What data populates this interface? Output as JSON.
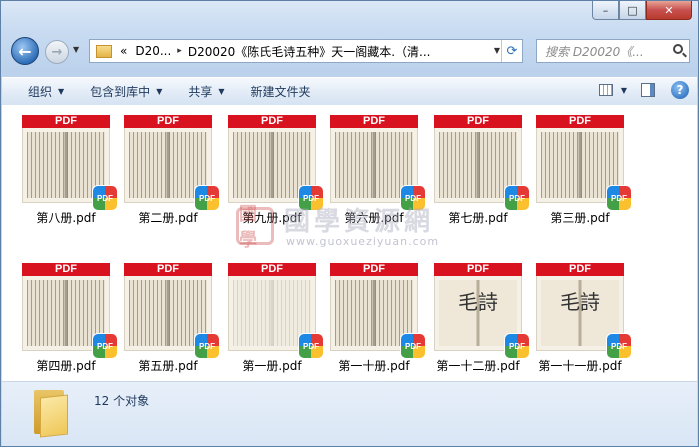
{
  "window": {
    "caption": {
      "minimize": "–",
      "maximize": "□",
      "close": "✕"
    }
  },
  "nav": {
    "back_glyph": "←",
    "forward_glyph": "→",
    "dropdown_glyph": "▼",
    "address": {
      "prefix": "«",
      "parent": "D20...",
      "separator": "▸",
      "current": "D20020《陈氏毛诗五种》天一阁藏本.（清...",
      "dropdown_glyph": "▼"
    },
    "refresh_glyph": "⟳",
    "search_placeholder": "搜索 D20020《..."
  },
  "toolbar": {
    "items": [
      {
        "label": "组织",
        "has_menu": true
      },
      {
        "label": "包含到库中",
        "has_menu": true
      },
      {
        "label": "共享",
        "has_menu": true
      },
      {
        "label": "新建文件夹",
        "has_menu": false
      }
    ],
    "menu_arrow": "▼",
    "help_glyph": "?"
  },
  "files": [
    {
      "name": "第八册.pdf",
      "band": "PDF",
      "badge": "PDF",
      "style": "scan"
    },
    {
      "name": "第二册.pdf",
      "band": "PDF",
      "badge": "PDF",
      "style": "scan"
    },
    {
      "name": "第九册.pdf",
      "band": "PDF",
      "badge": "PDF",
      "style": "scan"
    },
    {
      "name": "第六册.pdf",
      "band": "PDF",
      "badge": "PDF",
      "style": "scan"
    },
    {
      "name": "第七册.pdf",
      "band": "PDF",
      "badge": "PDF",
      "style": "scan"
    },
    {
      "name": "第三册.pdf",
      "band": "PDF",
      "badge": "PDF",
      "style": "scan"
    },
    {
      "name": "第四册.pdf",
      "band": "PDF",
      "badge": "PDF",
      "style": "scan"
    },
    {
      "name": "第五册.pdf",
      "band": "PDF",
      "badge": "PDF",
      "style": "scan"
    },
    {
      "name": "第一册.pdf",
      "band": "PDF",
      "badge": "PDF",
      "style": "light"
    },
    {
      "name": "第一十册.pdf",
      "band": "PDF",
      "badge": "PDF",
      "style": "scan"
    },
    {
      "name": "第一十二册.pdf",
      "band": "PDF",
      "badge": "PDF",
      "style": "big",
      "glyphs": "毛詩"
    },
    {
      "name": "第一十一册.pdf",
      "band": "PDF",
      "badge": "PDF",
      "style": "big",
      "glyphs": "毛詩"
    }
  ],
  "watermark": {
    "seal": "國學",
    "title": "國學資源網",
    "url": "www.guoxueziyuan.com"
  },
  "status": {
    "count_text": "12 个对象"
  }
}
